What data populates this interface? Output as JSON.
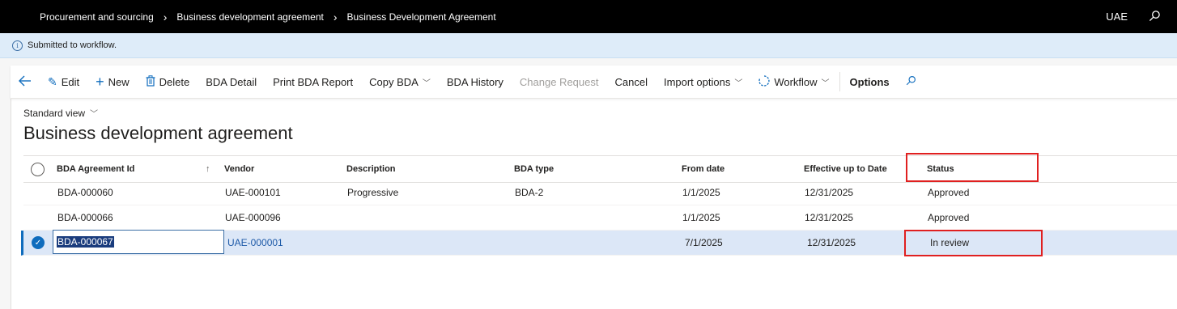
{
  "topbar": {
    "breadcrumbs": [
      "Procurement and sourcing",
      "Business development agreement",
      "Business Development Agreement"
    ],
    "company": "UAE",
    "search_icon": "search-icon"
  },
  "message": {
    "text": "Submitted to workflow."
  },
  "actions": {
    "edit": "Edit",
    "new": "New",
    "delete": "Delete",
    "bda_detail": "BDA Detail",
    "print_bda_report": "Print BDA Report",
    "copy_bda": "Copy BDA",
    "bda_history": "BDA History",
    "change_request": "Change Request",
    "cancel": "Cancel",
    "import_options": "Import options",
    "workflow": "Workflow",
    "options": "Options"
  },
  "view": {
    "label": "Standard view"
  },
  "page": {
    "title": "Business development agreement"
  },
  "grid": {
    "columns": [
      "BDA Agreement Id",
      "Vendor",
      "Description",
      "BDA type",
      "From date",
      "Effective up to Date",
      "Status"
    ],
    "rows": [
      {
        "id": "BDA-000060",
        "vendor": "UAE-000101",
        "description": "Progressive",
        "type": "BDA-2",
        "from": "1/1/2025",
        "to": "12/31/2025",
        "status": "Approved"
      },
      {
        "id": "BDA-000066",
        "vendor": "UAE-000096",
        "description": "",
        "type": "",
        "from": "1/1/2025",
        "to": "12/31/2025",
        "status": "Approved"
      },
      {
        "id": "BDA-000067",
        "vendor": "UAE-000001",
        "description": "",
        "type": "",
        "from": "7/1/2025",
        "to": "12/31/2025",
        "status": "In review"
      }
    ]
  },
  "colors": {
    "accent": "#0f6cbd",
    "highlight": "#e02020",
    "selected_row": "#dce7f7"
  }
}
